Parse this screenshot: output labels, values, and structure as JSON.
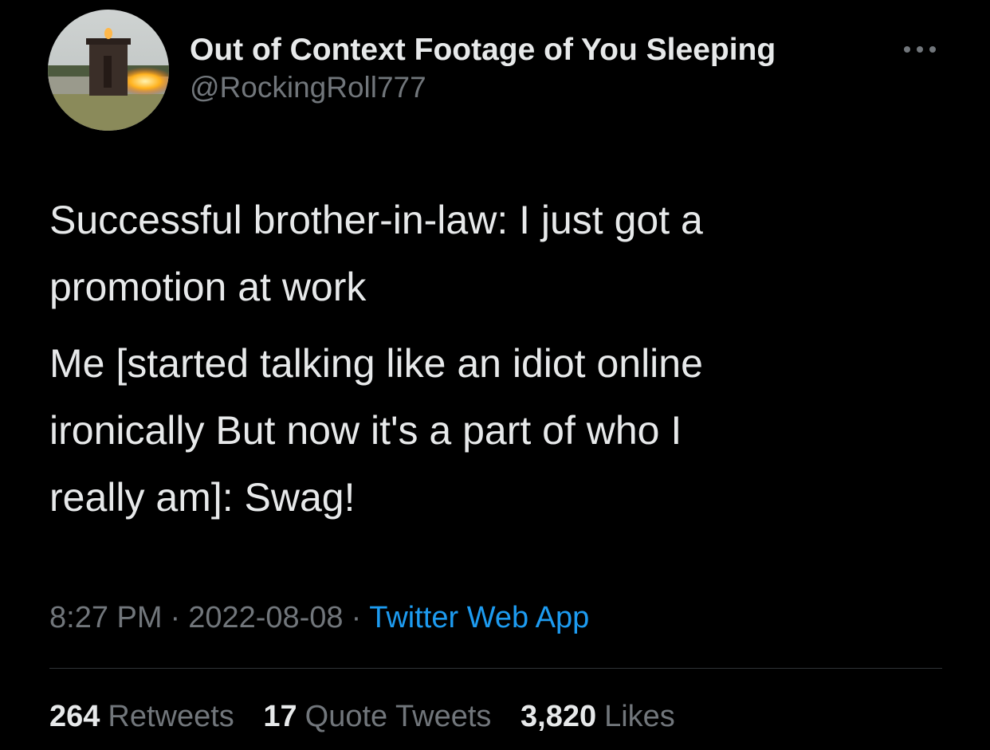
{
  "author": {
    "display_name": "Out of Context Footage of You Sleeping",
    "handle": "@RockingRoll777",
    "avatar_icon": "avatar-outhouse-fire-icon"
  },
  "more_icon": "more-dots-icon",
  "tweet": {
    "paragraphs": [
      "Successful brother-in-law: I just got a\npromotion at work",
      "Me [started talking like an idiot online\nironically But now it's a part of who I\nreally am]: Swag!"
    ],
    "time": "8:27 PM",
    "separator": "·",
    "date": "2022-08-08",
    "source": "Twitter Web App"
  },
  "stats": {
    "retweets": {
      "count": "264",
      "label": "Retweets"
    },
    "quote_tweets": {
      "count": "17",
      "label": "Quote Tweets"
    },
    "likes": {
      "count": "3,820",
      "label": "Likes"
    }
  },
  "colors": {
    "background": "#000000",
    "primary_text": "#e7e9ea",
    "secondary_text": "#71767b",
    "link": "#1d9bf0",
    "divider": "#2f3336"
  }
}
